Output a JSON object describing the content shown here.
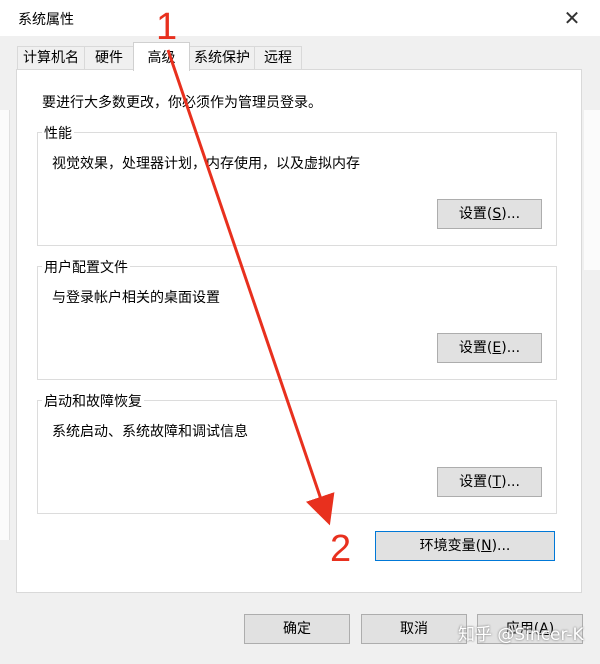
{
  "window": {
    "title": "系统属性",
    "close_glyph": "✕"
  },
  "tabs": [
    {
      "label": "计算机名",
      "active": false
    },
    {
      "label": "硬件",
      "active": false
    },
    {
      "label": "高级",
      "active": true
    },
    {
      "label": "系统保护",
      "active": false
    },
    {
      "label": "远程",
      "active": false
    }
  ],
  "advanced": {
    "admin_note": "要进行大多数更改，你必须作为管理员登录。",
    "performance": {
      "label": "性能",
      "description": "视觉效果，处理器计划，内存使用，以及虚拟内存",
      "button_pre": "设置(",
      "button_key": "S",
      "button_post": ")..."
    },
    "user_profiles": {
      "label": "用户配置文件",
      "description": "与登录帐户相关的桌面设置",
      "button_pre": "设置(",
      "button_key": "E",
      "button_post": ")..."
    },
    "startup_recovery": {
      "label": "启动和故障恢复",
      "description": "系统启动、系统故障和调试信息",
      "button_pre": "设置(",
      "button_key": "T",
      "button_post": ")..."
    },
    "env_button": {
      "pre": "环境变量(",
      "key": "N",
      "post": ")..."
    }
  },
  "footer": {
    "ok": "确定",
    "cancel": "取消",
    "apply_pre": "应用(",
    "apply_key": "A",
    "apply_post": ")"
  },
  "annotations": {
    "step1": "1",
    "step2": "2",
    "color": "#e8301e"
  },
  "watermark": "知乎 @Sincer-K"
}
